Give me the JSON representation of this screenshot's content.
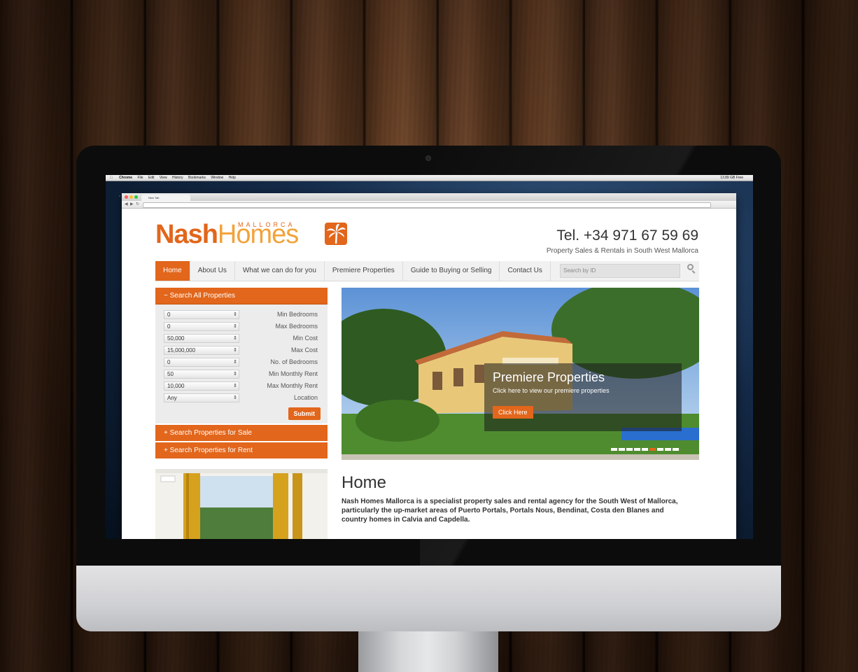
{
  "macos": {
    "app": "Chrome",
    "menu": [
      "File",
      "Edit",
      "View",
      "History",
      "Bookmarks",
      "Window",
      "Help"
    ],
    "status_right": "13.89 GB Free"
  },
  "browser": {
    "tab_title": "New Tab"
  },
  "site": {
    "logo": {
      "nash": "Nash",
      "homes": "Homes",
      "mallorca": "MALLORCA"
    },
    "phone": "Tel. +34 971 67 59 69",
    "tagline": "Property Sales & Rentals in South West Mallorca",
    "nav": [
      "Home",
      "About Us",
      "What we can do for you",
      "Premiere Properties",
      "Guide to Buying or Selling",
      "Contact Us"
    ],
    "search_placeholder": "Search by ID",
    "search_panel": {
      "heading": "Search All Properties",
      "fields": [
        {
          "value": "0",
          "label": "Min Bedrooms"
        },
        {
          "value": "0",
          "label": "Max Bedrooms"
        },
        {
          "value": "50,000",
          "label": "Min Cost"
        },
        {
          "value": "15,000,000",
          "label": "Max Cost"
        },
        {
          "value": "0",
          "label": "No. of Bedrooms"
        },
        {
          "value": "50",
          "label": "Min Monthly Rent"
        },
        {
          "value": "10,000",
          "label": "Max Monthly Rent"
        },
        {
          "value": "Any",
          "label": "Location"
        }
      ],
      "submit": "Submit"
    },
    "sale_panel": "Search Properties for Sale",
    "rent_panel": "Search Properties for Rent",
    "hero": {
      "title": "Premiere Properties",
      "subtitle": "Click here to view our premiere properties",
      "button": "Click Here"
    },
    "page_title": "Home",
    "intro": "Nash Homes Mallorca is a specialist property sales and rental agency for the South West of Mallorca, particularly the up-market areas of Puerto Portals, Portals Nous, Bendinat, Costa den Blanes and country homes in Calvia and Capdella."
  },
  "colors": {
    "accent": "#e2661b",
    "accent_light": "#f2a33a"
  }
}
